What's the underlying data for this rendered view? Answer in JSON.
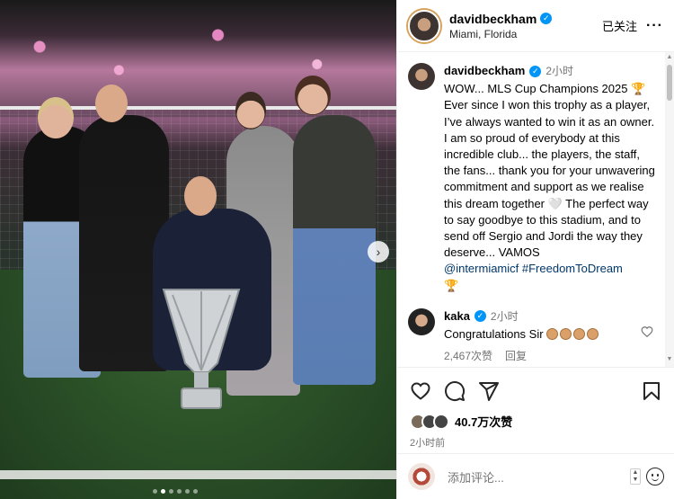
{
  "post": {
    "image_alt": "",
    "carousel": {
      "dots": 6,
      "active_index": 1
    }
  },
  "header": {
    "username": "davidbeckham",
    "location": "Miami, Florida",
    "follow_label": "已关注",
    "more_label": "···"
  },
  "caption": {
    "username": "davidbeckham",
    "time": "2小时",
    "text_part1": "WOW... MLS Cup Champions 2025 🏆 Ever since I won this trophy as a player, I’ve always wanted to win it as an owner. I am so proud of everybody at this incredible club... the players, the staff, the fans... thank you for your unwavering commitment and support as we realise this dream together 🤍 The perfect way to say goodbye to this stadium, and to send off Sergio and Jordi the way they deserve... VAMOS",
    "mention": "@intermiamicf",
    "hashtag": "#FreedomToDream",
    "trailing_emoji": "🏆"
  },
  "comment": {
    "username": "kaka",
    "time": "2小时",
    "text": "Congratulations Sir",
    "likes_label": "2,467次赞",
    "reply_label": "回复"
  },
  "actions": {
    "likes_count": "40.7万次赞",
    "time_ago": "2小时前"
  },
  "add_comment": {
    "placeholder": "添加评论..."
  },
  "colors": {
    "verified": "#0095f6",
    "link": "#00376b",
    "muted": "#737373"
  }
}
